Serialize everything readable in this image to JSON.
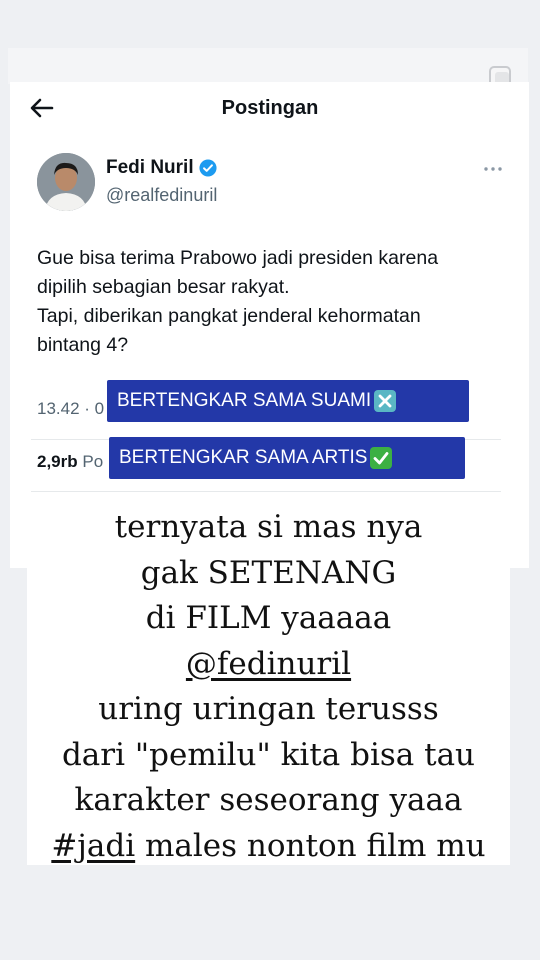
{
  "header": {
    "title": "Postingan"
  },
  "author": {
    "name": "Fedi Nuril",
    "handle": "@realfedinuril"
  },
  "tweet": {
    "lines": [
      "Gue bisa terima Prabowo jadi presiden karena",
      "dipilih sebagian besar rakyat.",
      "Tapi, diberikan pangkat jenderal kehormatan",
      "bintang 4?"
    ],
    "time_fragment": "13.42 · 0",
    "stats_count": "2,9rb",
    "stats_fragment": " Po"
  },
  "overlay_labels": {
    "label_1": "BERTENGKAR SAMA SUAMI",
    "label_2": "BERTENGKAR SAMA ARTIS"
  },
  "caption": {
    "line_1": "ternyata si mas nya",
    "line_2": "gak SETENANG",
    "line_3": "di FILM yaaaaa",
    "line_4": "@fedinuril",
    "line_5": "uring uringan terusss",
    "line_6": "dari \"pemilu\" kita bisa tau",
    "line_7": "karakter seseorang yaaa",
    "line_8_tag": "#jadi",
    "line_8_rest": " males nonton film mu"
  },
  "colors": {
    "label_bg": "#2338a8",
    "verified": "#1d9bf0",
    "check_emoji": "#3cb043",
    "cross_emoji": "#5ab7c4"
  },
  "icons": [
    "back-arrow-icon",
    "verified-badge-icon",
    "more-options-icon",
    "cross-mark-icon",
    "check-mark-icon"
  ]
}
